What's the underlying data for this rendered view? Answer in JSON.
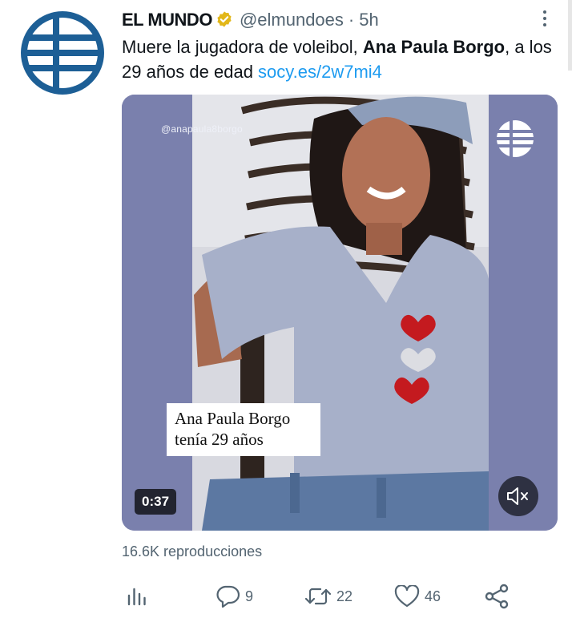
{
  "author": {
    "name": "EL MUNDO",
    "handle": "@elmundoes",
    "separator": "·",
    "time": "5h",
    "avatar_icon": "el-mundo-globe-logo",
    "verified_icon": "verified-gold-badge",
    "accent_color": "#1d5f96"
  },
  "tweet": {
    "text_before": "Muere la jugadora de voleibol, ",
    "text_bold": "Ana Paula Borgo",
    "text_after": ", a los 29 años de edad ",
    "link": "socy.es/2w7mi4",
    "link_color": "#1d9bf0"
  },
  "media": {
    "watermark": "@anapaula8borgo",
    "caption_line1": "Ana Paula Borgo",
    "caption_line2": "tenía 29 años",
    "duration": "0:37",
    "mute_icon": "speaker-muted-icon",
    "logo_icon": "el-mundo-globe-logo"
  },
  "stats": {
    "views": "16.6K reproducciones"
  },
  "actions": {
    "analytics_icon": "analytics-bars-icon",
    "replies": "9",
    "retweets": "22",
    "likes": "46",
    "share_icon": "share-icon"
  }
}
